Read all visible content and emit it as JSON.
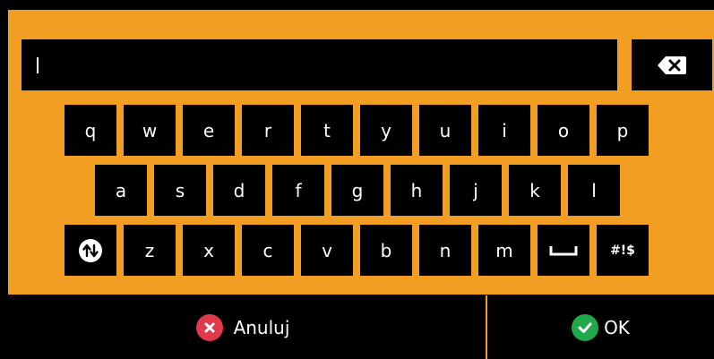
{
  "colors": {
    "accent": "#F29E22",
    "key_bg": "#000000",
    "cancel": "#E03A4A",
    "ok": "#1FA94A"
  },
  "input": {
    "value": ""
  },
  "keys": {
    "row1": [
      "q",
      "w",
      "e",
      "r",
      "t",
      "y",
      "u",
      "i",
      "o",
      "p"
    ],
    "row2": [
      "a",
      "s",
      "d",
      "f",
      "g",
      "h",
      "j",
      "k",
      "l"
    ],
    "row3": [
      "z",
      "x",
      "c",
      "v",
      "b",
      "n",
      "m"
    ],
    "symbols": "#!$"
  },
  "icons": {
    "backspace": "backspace-icon",
    "shift": "shift-icon",
    "space": "space-icon",
    "cancel": "close-icon",
    "ok": "check-icon"
  },
  "actions": {
    "cancel_label": "Anuluj",
    "ok_label": "OK"
  }
}
